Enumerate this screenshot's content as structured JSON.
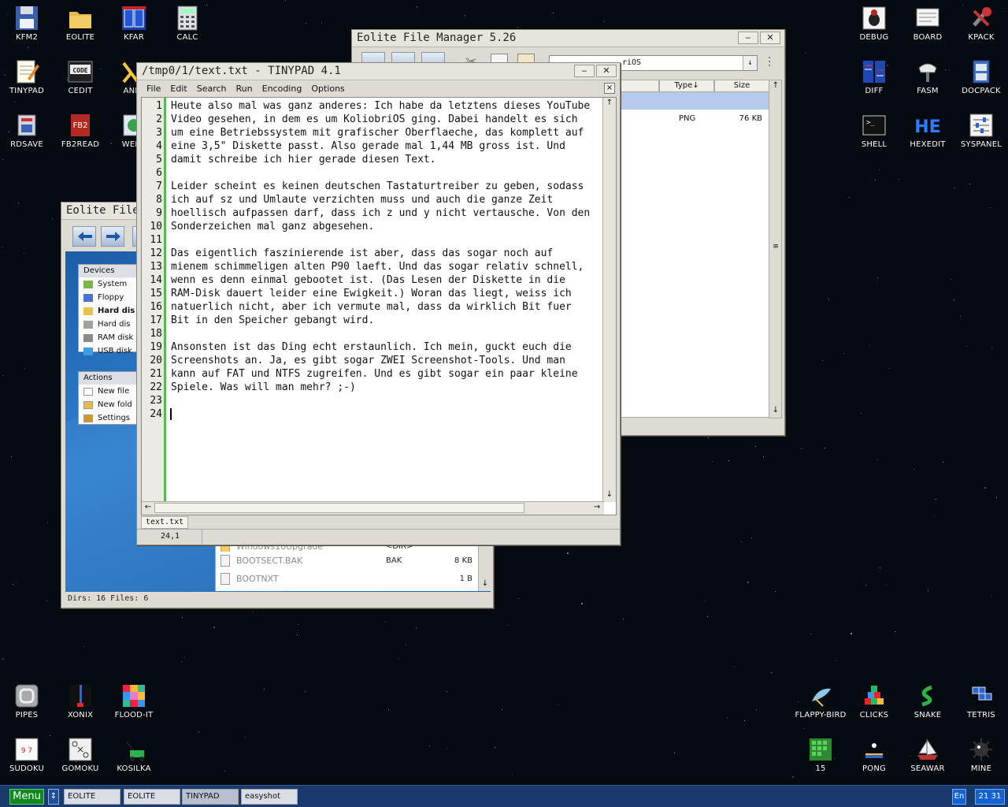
{
  "desktop": {
    "icons": [
      {
        "label": "KFM2",
        "icon": "floppy-icon"
      },
      {
        "label": "EOLITE",
        "icon": "folder-icon"
      },
      {
        "label": "KFAR",
        "icon": "far-panels-icon"
      },
      {
        "label": "CALC",
        "icon": "calculator-icon"
      },
      {
        "label": "TINYPAD",
        "icon": "notepad-icon"
      },
      {
        "label": "CEDIT",
        "icon": "code-icon"
      },
      {
        "label": "ANIM",
        "icon": "anim-icon"
      },
      {
        "label": "RDSAVE",
        "icon": "ramdisk-save-icon"
      },
      {
        "label": "FB2READ",
        "icon": "book-icon"
      },
      {
        "label": "WEBV",
        "icon": "web-icon"
      },
      {
        "label": "DEBUG",
        "icon": "bug-icon"
      },
      {
        "label": "BOARD",
        "icon": "board-icon"
      },
      {
        "label": "KPACK",
        "icon": "wrench-icon"
      },
      {
        "label": "DIFF",
        "icon": "diff-icon"
      },
      {
        "label": "FASM",
        "icon": "fasm-icon"
      },
      {
        "label": "DOCPACK",
        "icon": "cabinet-icon"
      },
      {
        "label": "SHELL",
        "icon": "terminal-icon"
      },
      {
        "label": "HEXEDIT",
        "icon": "hex-icon"
      },
      {
        "label": "SYSPANEL",
        "icon": "sliders-icon"
      },
      {
        "label": "PIPES",
        "icon": "pipes-icon"
      },
      {
        "label": "XONIX",
        "icon": "xonix-icon"
      },
      {
        "label": "FLOOD-IT",
        "icon": "flood-icon"
      },
      {
        "label": "SUDOKU",
        "icon": "sudoku-icon"
      },
      {
        "label": "GOMOKU",
        "icon": "gomoku-icon"
      },
      {
        "label": "KOSILKA",
        "icon": "lawnmower-icon"
      },
      {
        "label": "FLAPPY-BIRD",
        "icon": "bird-icon"
      },
      {
        "label": "CLICKS",
        "icon": "blocks-icon"
      },
      {
        "label": "SNAKE",
        "icon": "snake-icon"
      },
      {
        "label": "TETRIS",
        "icon": "tetris-icon"
      },
      {
        "label": "15",
        "icon": "fifteen-icon"
      },
      {
        "label": "PONG",
        "icon": "pong-icon"
      },
      {
        "label": "SEAWAR",
        "icon": "ship-icon"
      },
      {
        "label": "MINE",
        "icon": "mine-icon"
      }
    ]
  },
  "fm_back": {
    "title": "Eolite File",
    "devices_header": "Devices",
    "devices": [
      "System",
      "Floppy",
      "Hard dis",
      "Hard dis",
      "RAM disk",
      "USB disk"
    ],
    "actions_header": "Actions",
    "actions": [
      "New file",
      "New fold",
      "Settings"
    ],
    "files": [
      {
        "name": "Windows10Upgrade",
        "type": "<DIR>",
        "size": ""
      },
      {
        "name": "BOOTSECT.BAK",
        "type": "BAK",
        "size": "8 KB"
      },
      {
        "name": "BOOTNXT",
        "type": "",
        "size": "1 B"
      }
    ],
    "status": "Dirs: 16   Files: 6"
  },
  "fm_front": {
    "title": "Eolite File Manager 5.26",
    "path": "riOS",
    "col_type": "Type↓",
    "col_size": "Size",
    "row": {
      "type": "PNG",
      "size": "76 KB"
    }
  },
  "tinypad": {
    "title": "/tmp0/1/text.txt - TINYPAD 4.1",
    "menu": [
      "File",
      "Edit",
      "Search",
      "Run",
      "Encoding",
      "Options"
    ],
    "close_glyph": "×",
    "lines": [
      "Heute also mal was ganz anderes: Ich habe da letztens dieses YouTube",
      "Video gesehen, in dem es um KoliobriOS ging. Dabei handelt es sich",
      "um eine Betriebssystem mit grafischer Oberflaeche, das komplett auf",
      "eine 3,5\" Diskette passt. Also gerade mal 1,44 MB gross ist. Und",
      "damit schreibe ich hier gerade diesen Text.",
      "",
      "Leider scheint es keinen deutschen Tastaturtreiber zu geben, sodass",
      "ich auf sz und Umlaute verzichten muss und auch die ganze Zeit",
      "hoellisch aufpassen darf, dass ich z und y nicht vertausche. Von den",
      "Sonderzeichen mal ganz abgesehen.",
      "",
      "Das eigentlich faszinierende ist aber, dass das sogar noch auf",
      "mienem schimmeligen alten P90 laeft. Und das sogar relativ schnell,",
      "wenn es denn einmal gebootet ist. (Das Lesen der Diskette in die",
      "RAM-Disk dauert leider eine Ewigkeit.) Woran das liegt, weiss ich",
      "natuerlich nicht, aber ich vermute mal, dass da wirklich Bit fuer",
      "Bit in den Speicher gebangt wird.",
      "",
      "Ansonsten ist das Ding echt erstaunlich. Ich mein, guckt euch die",
      "Screenshots an. Ja, es gibt sogar ZWEI Screenshot-Tools. Und man",
      "kann auf FAT und NTFS zugreifen. Und es gibt sogar ein paar kleine",
      "Spiele. Was will man mehr? ;-)",
      "",
      ""
    ],
    "tab": "text.txt",
    "cursor_pos": "24,1"
  },
  "taskbar": {
    "menu_label": "Menu",
    "swap_glyph": "↕",
    "tasks": [
      "EOLITE",
      "EOLITE",
      "TINYPAD",
      "easyshot"
    ],
    "lang": "En",
    "clock": "21 31"
  },
  "colors": {
    "accent_green": "#56b94d",
    "taskbar": "#1a3a6e",
    "menu_button": "#11871f"
  }
}
